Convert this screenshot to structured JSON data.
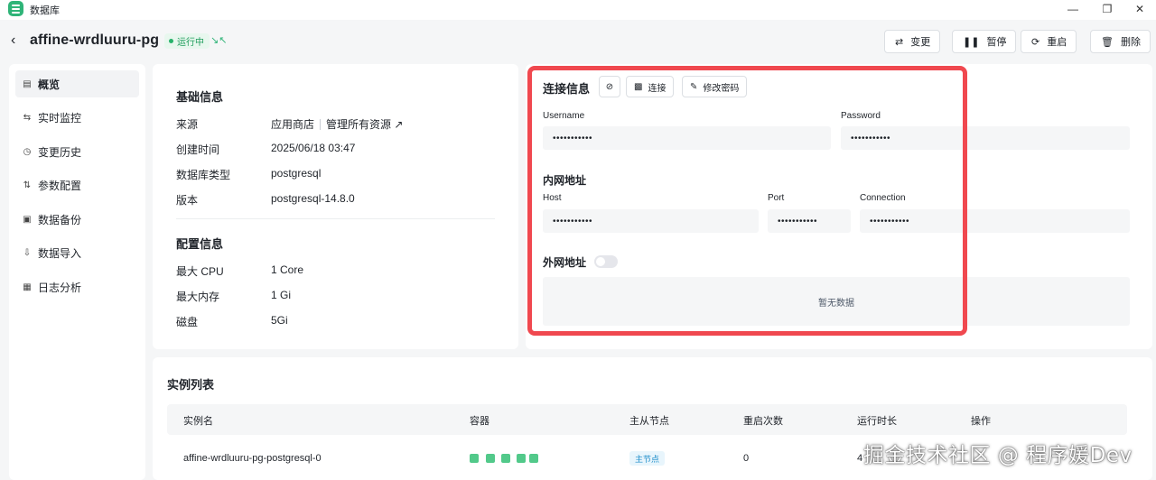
{
  "window": {
    "title": "数据库"
  },
  "header": {
    "title": "affine-wrdluuru-pg",
    "status": "运行中",
    "actions": {
      "change": "变更",
      "pause": "暂停",
      "restart": "重启",
      "delete": "删除"
    }
  },
  "sidebar": {
    "items": [
      {
        "label": "概览",
        "icon": "server-icon",
        "active": true
      },
      {
        "label": "实时监控",
        "icon": "monitor-icon"
      },
      {
        "label": "变更历史",
        "icon": "history-icon"
      },
      {
        "label": "参数配置",
        "icon": "sliders-icon"
      },
      {
        "label": "数据备份",
        "icon": "backup-icon"
      },
      {
        "label": "数据导入",
        "icon": "import-icon"
      },
      {
        "label": "日志分析",
        "icon": "log-icon"
      }
    ]
  },
  "basic": {
    "title": "基础信息",
    "rows": [
      {
        "label": "来源",
        "value": "应用商店",
        "link": "管理所有资源"
      },
      {
        "label": "创建时间",
        "value": "2025/06/18 03:47"
      },
      {
        "label": "数据库类型",
        "value": "postgresql"
      },
      {
        "label": "版本",
        "value": "postgresql-14.8.0"
      }
    ]
  },
  "config": {
    "title": "配置信息",
    "rows": [
      {
        "label": "最大 CPU",
        "value": "1 Core"
      },
      {
        "label": "最大内存",
        "value": "1 Gi"
      },
      {
        "label": "磁盘",
        "value": "5Gi"
      }
    ]
  },
  "connection": {
    "title": "连接信息",
    "connect_label": "连接",
    "change_password_label": "修改密码",
    "username_label": "Username",
    "username_value": "•••••••••••",
    "password_label": "Password",
    "password_value": "•••••••••••",
    "internal_title": "内网地址",
    "host_label": "Host",
    "host_value": "•••••••••••",
    "port_label": "Port",
    "port_value": "•••••••••••",
    "connection_label": "Connection",
    "connection_value": "•••••••••••",
    "external_title": "外网地址",
    "external_enabled": false,
    "empty_text": "暂无数据"
  },
  "instances": {
    "title": "实例列表",
    "columns": [
      "实例名",
      "容器",
      "主从节点",
      "重启次数",
      "运行时长",
      "操作"
    ],
    "rows": [
      {
        "name": "affine-wrdluuru-pg-postgresql-0",
        "containers": 5,
        "role": "主节点",
        "restarts": "0",
        "uptime": "4"
      }
    ]
  },
  "watermark": "掘金技术社区 @ 程序媛Dev",
  "colors": {
    "accent": "#2fb478",
    "highlight": "#f0484f",
    "container_ok": "#52c98a"
  }
}
